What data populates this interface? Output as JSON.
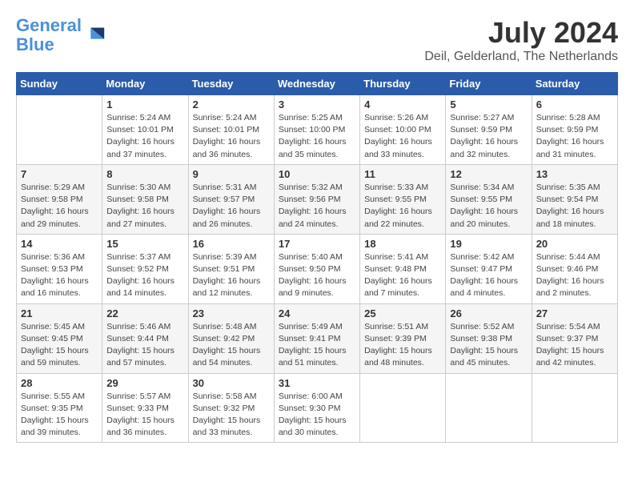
{
  "logo": {
    "line1": "General",
    "line2": "Blue"
  },
  "title": "July 2024",
  "location": "Deil, Gelderland, The Netherlands",
  "days_header": [
    "Sunday",
    "Monday",
    "Tuesday",
    "Wednesday",
    "Thursday",
    "Friday",
    "Saturday"
  ],
  "weeks": [
    [
      {
        "day": "",
        "info": ""
      },
      {
        "day": "1",
        "info": "Sunrise: 5:24 AM\nSunset: 10:01 PM\nDaylight: 16 hours\nand 37 minutes."
      },
      {
        "day": "2",
        "info": "Sunrise: 5:24 AM\nSunset: 10:01 PM\nDaylight: 16 hours\nand 36 minutes."
      },
      {
        "day": "3",
        "info": "Sunrise: 5:25 AM\nSunset: 10:00 PM\nDaylight: 16 hours\nand 35 minutes."
      },
      {
        "day": "4",
        "info": "Sunrise: 5:26 AM\nSunset: 10:00 PM\nDaylight: 16 hours\nand 33 minutes."
      },
      {
        "day": "5",
        "info": "Sunrise: 5:27 AM\nSunset: 9:59 PM\nDaylight: 16 hours\nand 32 minutes."
      },
      {
        "day": "6",
        "info": "Sunrise: 5:28 AM\nSunset: 9:59 PM\nDaylight: 16 hours\nand 31 minutes."
      }
    ],
    [
      {
        "day": "7",
        "info": "Sunrise: 5:29 AM\nSunset: 9:58 PM\nDaylight: 16 hours\nand 29 minutes."
      },
      {
        "day": "8",
        "info": "Sunrise: 5:30 AM\nSunset: 9:58 PM\nDaylight: 16 hours\nand 27 minutes."
      },
      {
        "day": "9",
        "info": "Sunrise: 5:31 AM\nSunset: 9:57 PM\nDaylight: 16 hours\nand 26 minutes."
      },
      {
        "day": "10",
        "info": "Sunrise: 5:32 AM\nSunset: 9:56 PM\nDaylight: 16 hours\nand 24 minutes."
      },
      {
        "day": "11",
        "info": "Sunrise: 5:33 AM\nSunset: 9:55 PM\nDaylight: 16 hours\nand 22 minutes."
      },
      {
        "day": "12",
        "info": "Sunrise: 5:34 AM\nSunset: 9:55 PM\nDaylight: 16 hours\nand 20 minutes."
      },
      {
        "day": "13",
        "info": "Sunrise: 5:35 AM\nSunset: 9:54 PM\nDaylight: 16 hours\nand 18 minutes."
      }
    ],
    [
      {
        "day": "14",
        "info": "Sunrise: 5:36 AM\nSunset: 9:53 PM\nDaylight: 16 hours\nand 16 minutes."
      },
      {
        "day": "15",
        "info": "Sunrise: 5:37 AM\nSunset: 9:52 PM\nDaylight: 16 hours\nand 14 minutes."
      },
      {
        "day": "16",
        "info": "Sunrise: 5:39 AM\nSunset: 9:51 PM\nDaylight: 16 hours\nand 12 minutes."
      },
      {
        "day": "17",
        "info": "Sunrise: 5:40 AM\nSunset: 9:50 PM\nDaylight: 16 hours\nand 9 minutes."
      },
      {
        "day": "18",
        "info": "Sunrise: 5:41 AM\nSunset: 9:48 PM\nDaylight: 16 hours\nand 7 minutes."
      },
      {
        "day": "19",
        "info": "Sunrise: 5:42 AM\nSunset: 9:47 PM\nDaylight: 16 hours\nand 4 minutes."
      },
      {
        "day": "20",
        "info": "Sunrise: 5:44 AM\nSunset: 9:46 PM\nDaylight: 16 hours\nand 2 minutes."
      }
    ],
    [
      {
        "day": "21",
        "info": "Sunrise: 5:45 AM\nSunset: 9:45 PM\nDaylight: 15 hours\nand 59 minutes."
      },
      {
        "day": "22",
        "info": "Sunrise: 5:46 AM\nSunset: 9:44 PM\nDaylight: 15 hours\nand 57 minutes."
      },
      {
        "day": "23",
        "info": "Sunrise: 5:48 AM\nSunset: 9:42 PM\nDaylight: 15 hours\nand 54 minutes."
      },
      {
        "day": "24",
        "info": "Sunrise: 5:49 AM\nSunset: 9:41 PM\nDaylight: 15 hours\nand 51 minutes."
      },
      {
        "day": "25",
        "info": "Sunrise: 5:51 AM\nSunset: 9:39 PM\nDaylight: 15 hours\nand 48 minutes."
      },
      {
        "day": "26",
        "info": "Sunrise: 5:52 AM\nSunset: 9:38 PM\nDaylight: 15 hours\nand 45 minutes."
      },
      {
        "day": "27",
        "info": "Sunrise: 5:54 AM\nSunset: 9:37 PM\nDaylight: 15 hours\nand 42 minutes."
      }
    ],
    [
      {
        "day": "28",
        "info": "Sunrise: 5:55 AM\nSunset: 9:35 PM\nDaylight: 15 hours\nand 39 minutes."
      },
      {
        "day": "29",
        "info": "Sunrise: 5:57 AM\nSunset: 9:33 PM\nDaylight: 15 hours\nand 36 minutes."
      },
      {
        "day": "30",
        "info": "Sunrise: 5:58 AM\nSunset: 9:32 PM\nDaylight: 15 hours\nand 33 minutes."
      },
      {
        "day": "31",
        "info": "Sunrise: 6:00 AM\nSunset: 9:30 PM\nDaylight: 15 hours\nand 30 minutes."
      },
      {
        "day": "",
        "info": ""
      },
      {
        "day": "",
        "info": ""
      },
      {
        "day": "",
        "info": ""
      }
    ]
  ]
}
